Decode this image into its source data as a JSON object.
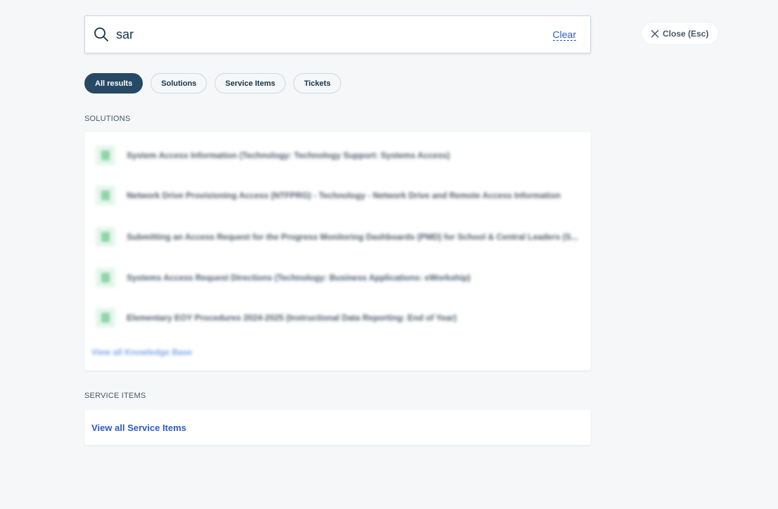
{
  "search": {
    "value": "sar",
    "clear_label": "Clear"
  },
  "close": {
    "label": "Close (Esc)"
  },
  "tabs": [
    {
      "label": "All results",
      "active": true
    },
    {
      "label": "Solutions",
      "active": false
    },
    {
      "label": "Service Items",
      "active": false
    },
    {
      "label": "Tickets",
      "active": false
    }
  ],
  "solutions": {
    "heading": "SOLUTIONS",
    "items": [
      {
        "title": "System Access Information (Technology: Technology Support: Systems Access)"
      },
      {
        "title": "Network Drive Provisioning Access (NTFPRG) - Technology - Network Drive and Remote Access Information"
      },
      {
        "title": "Submitting an Access Request for the Progress Monitoring Dashboards (PMD) for School & Central Leaders (S..."
      },
      {
        "title": "Systems Access Request Directions (Technology: Business Applications: eWorkship)"
      },
      {
        "title": "Elementary EOY Procedures 2024-2025 (Instructional Data Reporting: End of Year)"
      }
    ],
    "view_all_label": "View all Knowledge Base"
  },
  "service_items": {
    "heading": "SERVICE ITEMS",
    "view_all_label": "View all Service Items"
  },
  "colors": {
    "accent": "#264966",
    "link": "#2c5cc5",
    "background": "#f5f7f9",
    "solution_icon": "#8fd3a8"
  },
  "icons": {
    "search": "search-icon",
    "close": "close-icon",
    "solution": "document-icon"
  }
}
